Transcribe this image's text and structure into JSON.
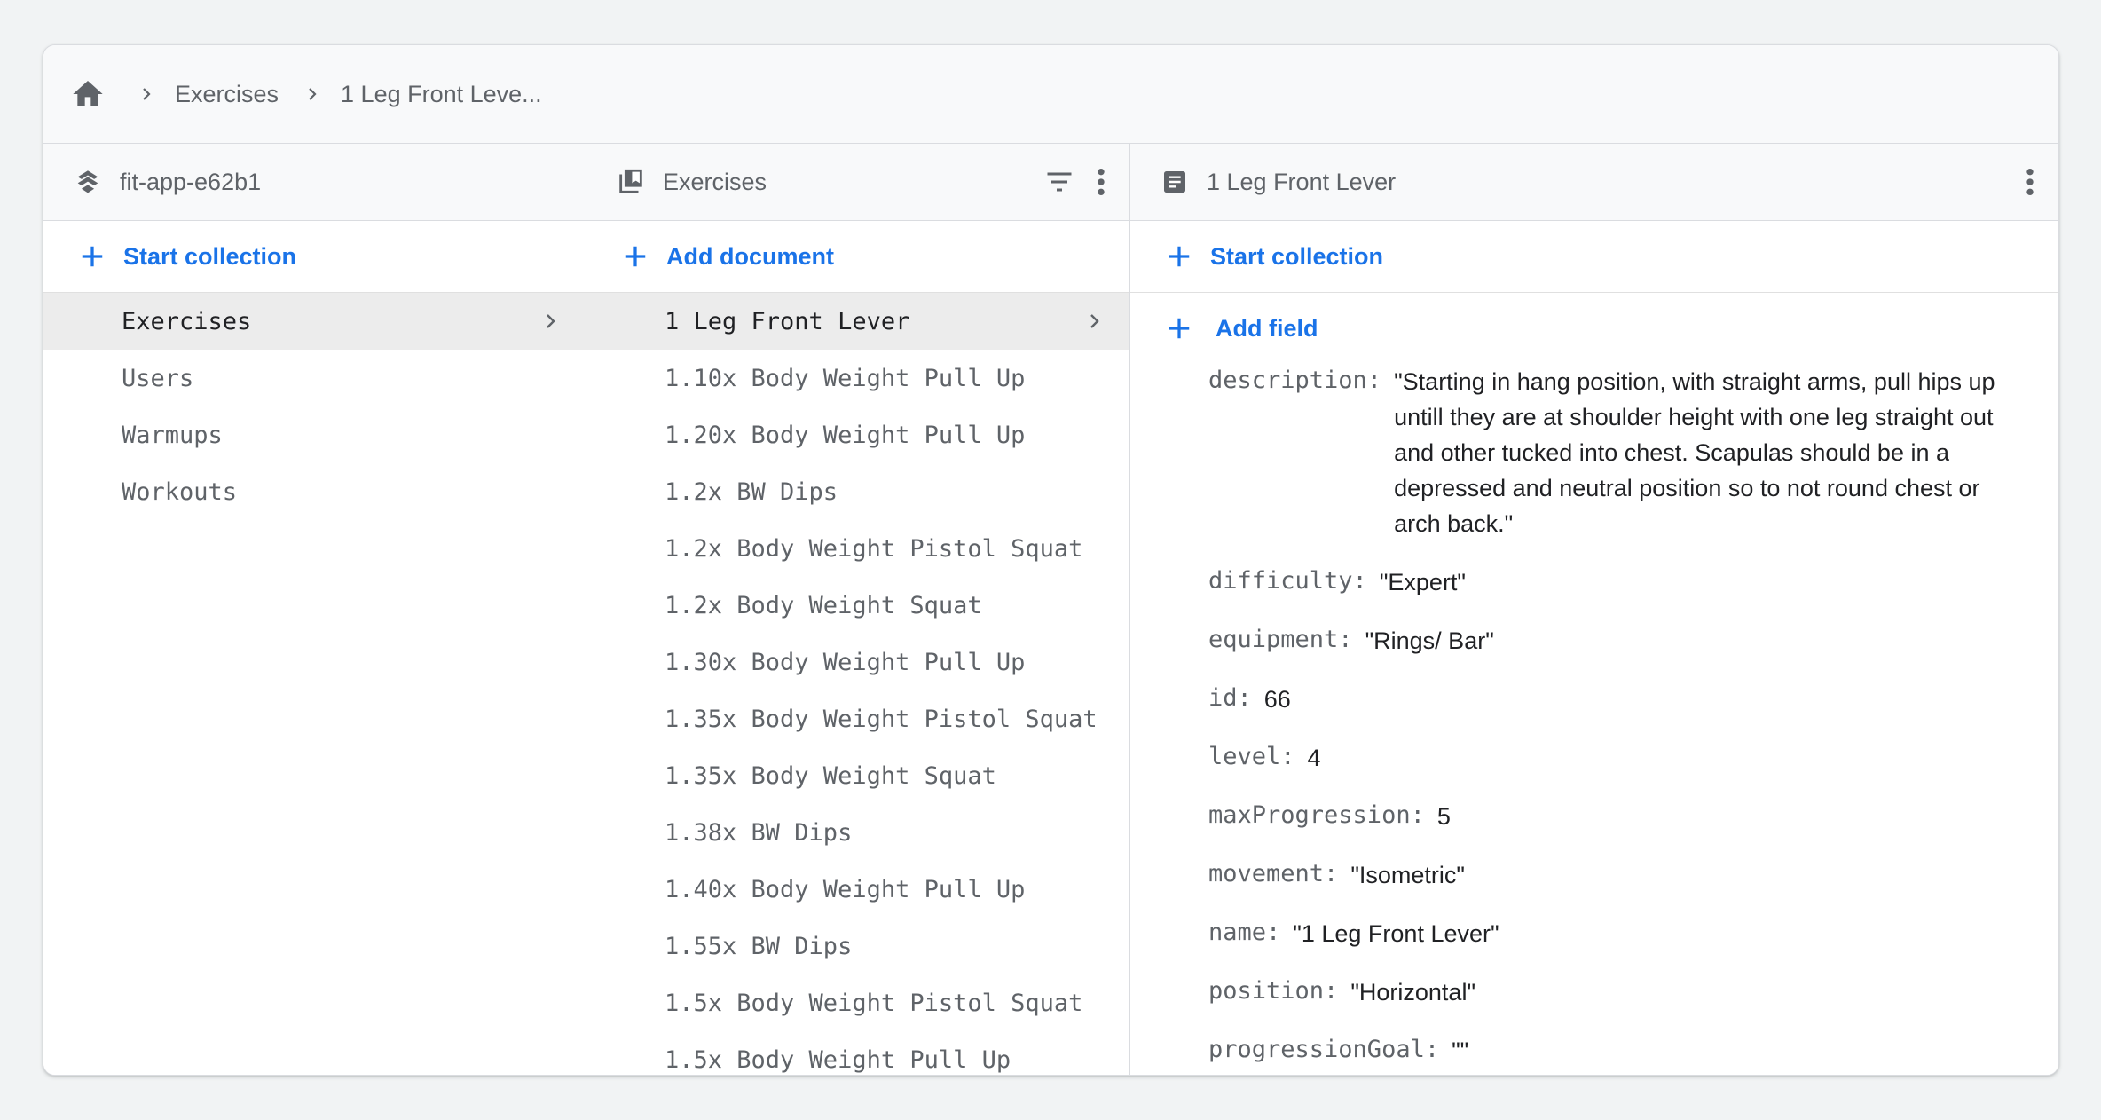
{
  "breadcrumb": {
    "items": [
      "Exercises",
      "1 Leg Front Leve..."
    ]
  },
  "columns": {
    "project": {
      "title": "fit-app-e62b1",
      "add_label": "Start collection",
      "items": [
        "Exercises",
        "Users",
        "Warmups",
        "Workouts"
      ],
      "selected_index": 0
    },
    "collection": {
      "title": "Exercises",
      "add_label": "Add document",
      "items": [
        "1 Leg Front Lever",
        "1.10x Body Weight Pull Up",
        "1.20x Body Weight Pull Up",
        "1.2x BW Dips",
        "1.2x Body Weight Pistol Squat",
        "1.2x Body Weight Squat",
        "1.30x Body Weight Pull Up",
        "1.35x Body Weight Pistol Squat",
        "1.35x Body Weight Squat",
        "1.38x BW Dips",
        "1.40x Body Weight Pull Up",
        "1.55x BW Dips",
        "1.5x Body Weight Pistol Squat",
        "1.5x Body Weight Pull Up"
      ],
      "selected_index": 0
    },
    "document": {
      "title": "1 Leg Front Lever",
      "add_collection_label": "Start collection",
      "add_field_label": "Add field",
      "fields": [
        {
          "key": "description:",
          "value": "\"Starting in hang position, with straight arms, pull hips up untill they are at shoulder height with one leg straight out and other tucked into chest. Scapulas should be in a depressed and neutral position so to not round chest or arch back.\""
        },
        {
          "key": "difficulty:",
          "value": "\"Expert\""
        },
        {
          "key": "equipment:",
          "value": "\"Rings/ Bar\""
        },
        {
          "key": "id:",
          "value": "66"
        },
        {
          "key": "level:",
          "value": "4"
        },
        {
          "key": "maxProgression:",
          "value": "5"
        },
        {
          "key": "movement:",
          "value": "\"Isometric\""
        },
        {
          "key": "name:",
          "value": "\"1 Leg Front Lever\""
        },
        {
          "key": "position:",
          "value": "\"Horizontal\""
        },
        {
          "key": "progressionGoal:",
          "value": "\"\""
        }
      ]
    }
  },
  "icons": {
    "home": "home-icon",
    "breadcrumb_separator": "chevron-right-icon",
    "project": "firestore-logo-icon",
    "collection": "collection-icon",
    "document": "document-icon",
    "filter": "filter-icon",
    "more": "more-vert-icon",
    "add": "plus-icon"
  },
  "colors": {
    "accent": "#1a73e8",
    "muted_text": "#5f6368",
    "selected_row": "#ececec"
  }
}
